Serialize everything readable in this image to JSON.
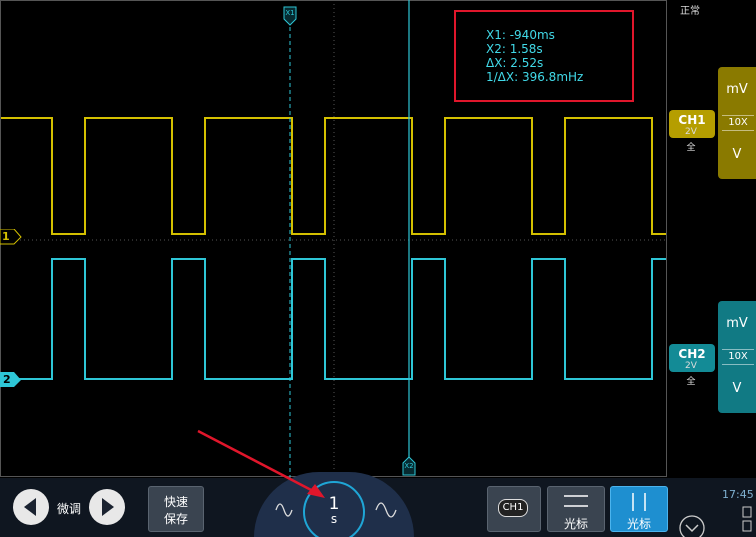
{
  "status": {
    "mode": "正常"
  },
  "cursor_readout": {
    "x1": "X1:  -940ms",
    "x2": "X2:  1.58s",
    "dx": "ΔX:  2.52s",
    "inv_dx": "1/ΔX:  396.8mHz"
  },
  "markers": {
    "x1_label": "X1",
    "x2_label": "X2",
    "ch1_marker": "1",
    "ch2_marker": "2"
  },
  "channels": [
    {
      "name": "CH1",
      "scale": "2V",
      "coupling": "全",
      "unit_top": "mV",
      "probe": "10X",
      "unit_bottom": "V",
      "color": "#c8b400"
    },
    {
      "name": "CH2",
      "scale": "2V",
      "coupling": "全",
      "unit_top": "mV",
      "probe": "10X",
      "unit_bottom": "V",
      "color": "#1fb9c8"
    }
  ],
  "bottom_bar": {
    "fine_label": "微调",
    "quick_save_line1": "快速",
    "quick_save_line2": "保存",
    "timebase_value": "1",
    "timebase_unit": "s",
    "ch1_button": "CH1",
    "cursor_h_label": "光标",
    "cursor_v_label": "光标",
    "clock": "17:45"
  },
  "colors": {
    "ch1": "#d4c000",
    "ch2": "#2ec6d6",
    "accent": "#1fa6d6",
    "highlight": "#e0162b"
  }
}
